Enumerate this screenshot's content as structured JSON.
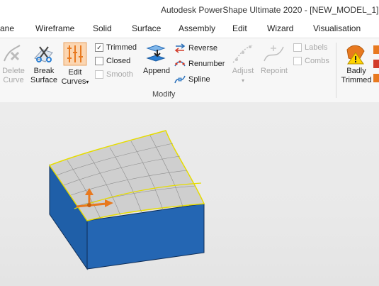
{
  "window": {
    "title": "Autodesk PowerShape Ultimate 2020 - [NEW_MODEL_1]"
  },
  "tabs": [
    "ane",
    "Wireframe",
    "Solid",
    "Surface",
    "Assembly",
    "Edit",
    "Wizard",
    "Visualisation"
  ],
  "ribbon": {
    "delete_curve": {
      "line1": "Delete",
      "line2": "Curve"
    },
    "break_surface": {
      "line1": "Break",
      "line2": "Surface"
    },
    "edit_curves": {
      "line1": "Edit",
      "line2": "Curves",
      "caret": "▾"
    },
    "checkboxes": [
      {
        "label": "Trimmed",
        "checked": true,
        "mark": "✓"
      },
      {
        "label": "Closed",
        "checked": false,
        "mark": ""
      },
      {
        "label": "Smooth",
        "checked": false,
        "mark": ""
      }
    ],
    "append": {
      "label": "Append"
    },
    "reverse": {
      "label": "Reverse"
    },
    "renumber": {
      "label": "Renumber"
    },
    "spline": {
      "label": "Spline"
    },
    "adjust": {
      "label": "Adjust",
      "caret": "▾"
    },
    "repoint": {
      "label": "Repoint"
    },
    "labels": {
      "label": "Labels",
      "mark": ""
    },
    "combs": {
      "label": "Combs",
      "mark": ""
    },
    "badly_trimmed": {
      "line1": "Badly",
      "line2": "Trimmed"
    },
    "group_label": "Modify"
  },
  "colors": {
    "solid_blue": "#1f5fa8",
    "surface_edge": "#e6dc00",
    "arrow_orange": "#e8791f"
  }
}
